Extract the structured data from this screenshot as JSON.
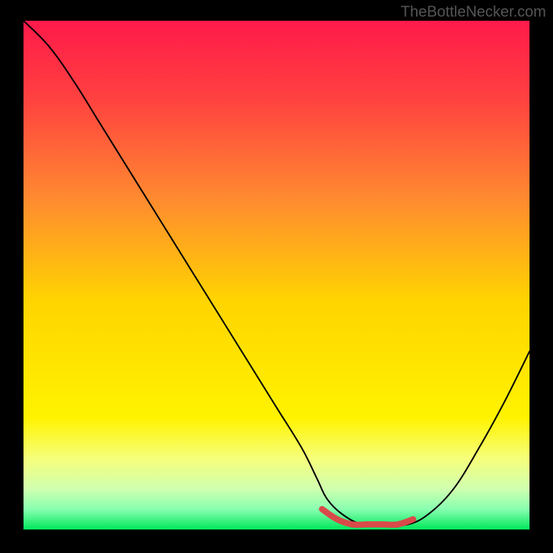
{
  "watermark": "TheBottleNecker.com",
  "chart_data": {
    "type": "line",
    "title": "",
    "xlabel": "",
    "ylabel": "",
    "xlim": [
      0,
      100
    ],
    "ylim": [
      0,
      100
    ],
    "background_gradient": {
      "stops": [
        {
          "offset": 0.0,
          "color": "#ff1a4a"
        },
        {
          "offset": 0.15,
          "color": "#ff4040"
        },
        {
          "offset": 0.35,
          "color": "#ff8a30"
        },
        {
          "offset": 0.55,
          "color": "#ffd400"
        },
        {
          "offset": 0.78,
          "color": "#fff300"
        },
        {
          "offset": 0.86,
          "color": "#f6ff7a"
        },
        {
          "offset": 0.92,
          "color": "#d0ffb0"
        },
        {
          "offset": 0.96,
          "color": "#88ffb0"
        },
        {
          "offset": 1.0,
          "color": "#00e85a"
        }
      ]
    },
    "series": [
      {
        "name": "bottleneck-curve",
        "color": "#000000",
        "x": [
          0,
          5,
          10,
          15,
          20,
          25,
          30,
          35,
          40,
          45,
          50,
          55,
          58,
          60,
          63,
          67,
          72,
          76,
          80,
          85,
          90,
          95,
          100
        ],
        "values": [
          100,
          95,
          88,
          80,
          72,
          64,
          56,
          48,
          40,
          32,
          24,
          16,
          10,
          6,
          3,
          1,
          1,
          1,
          3,
          8,
          16,
          25,
          35
        ]
      },
      {
        "name": "highlight-segment",
        "color": "#d94a4a",
        "x": [
          59,
          62,
          65,
          68,
          71,
          74,
          77
        ],
        "values": [
          4,
          2,
          1,
          1,
          1,
          1,
          2
        ]
      }
    ]
  }
}
